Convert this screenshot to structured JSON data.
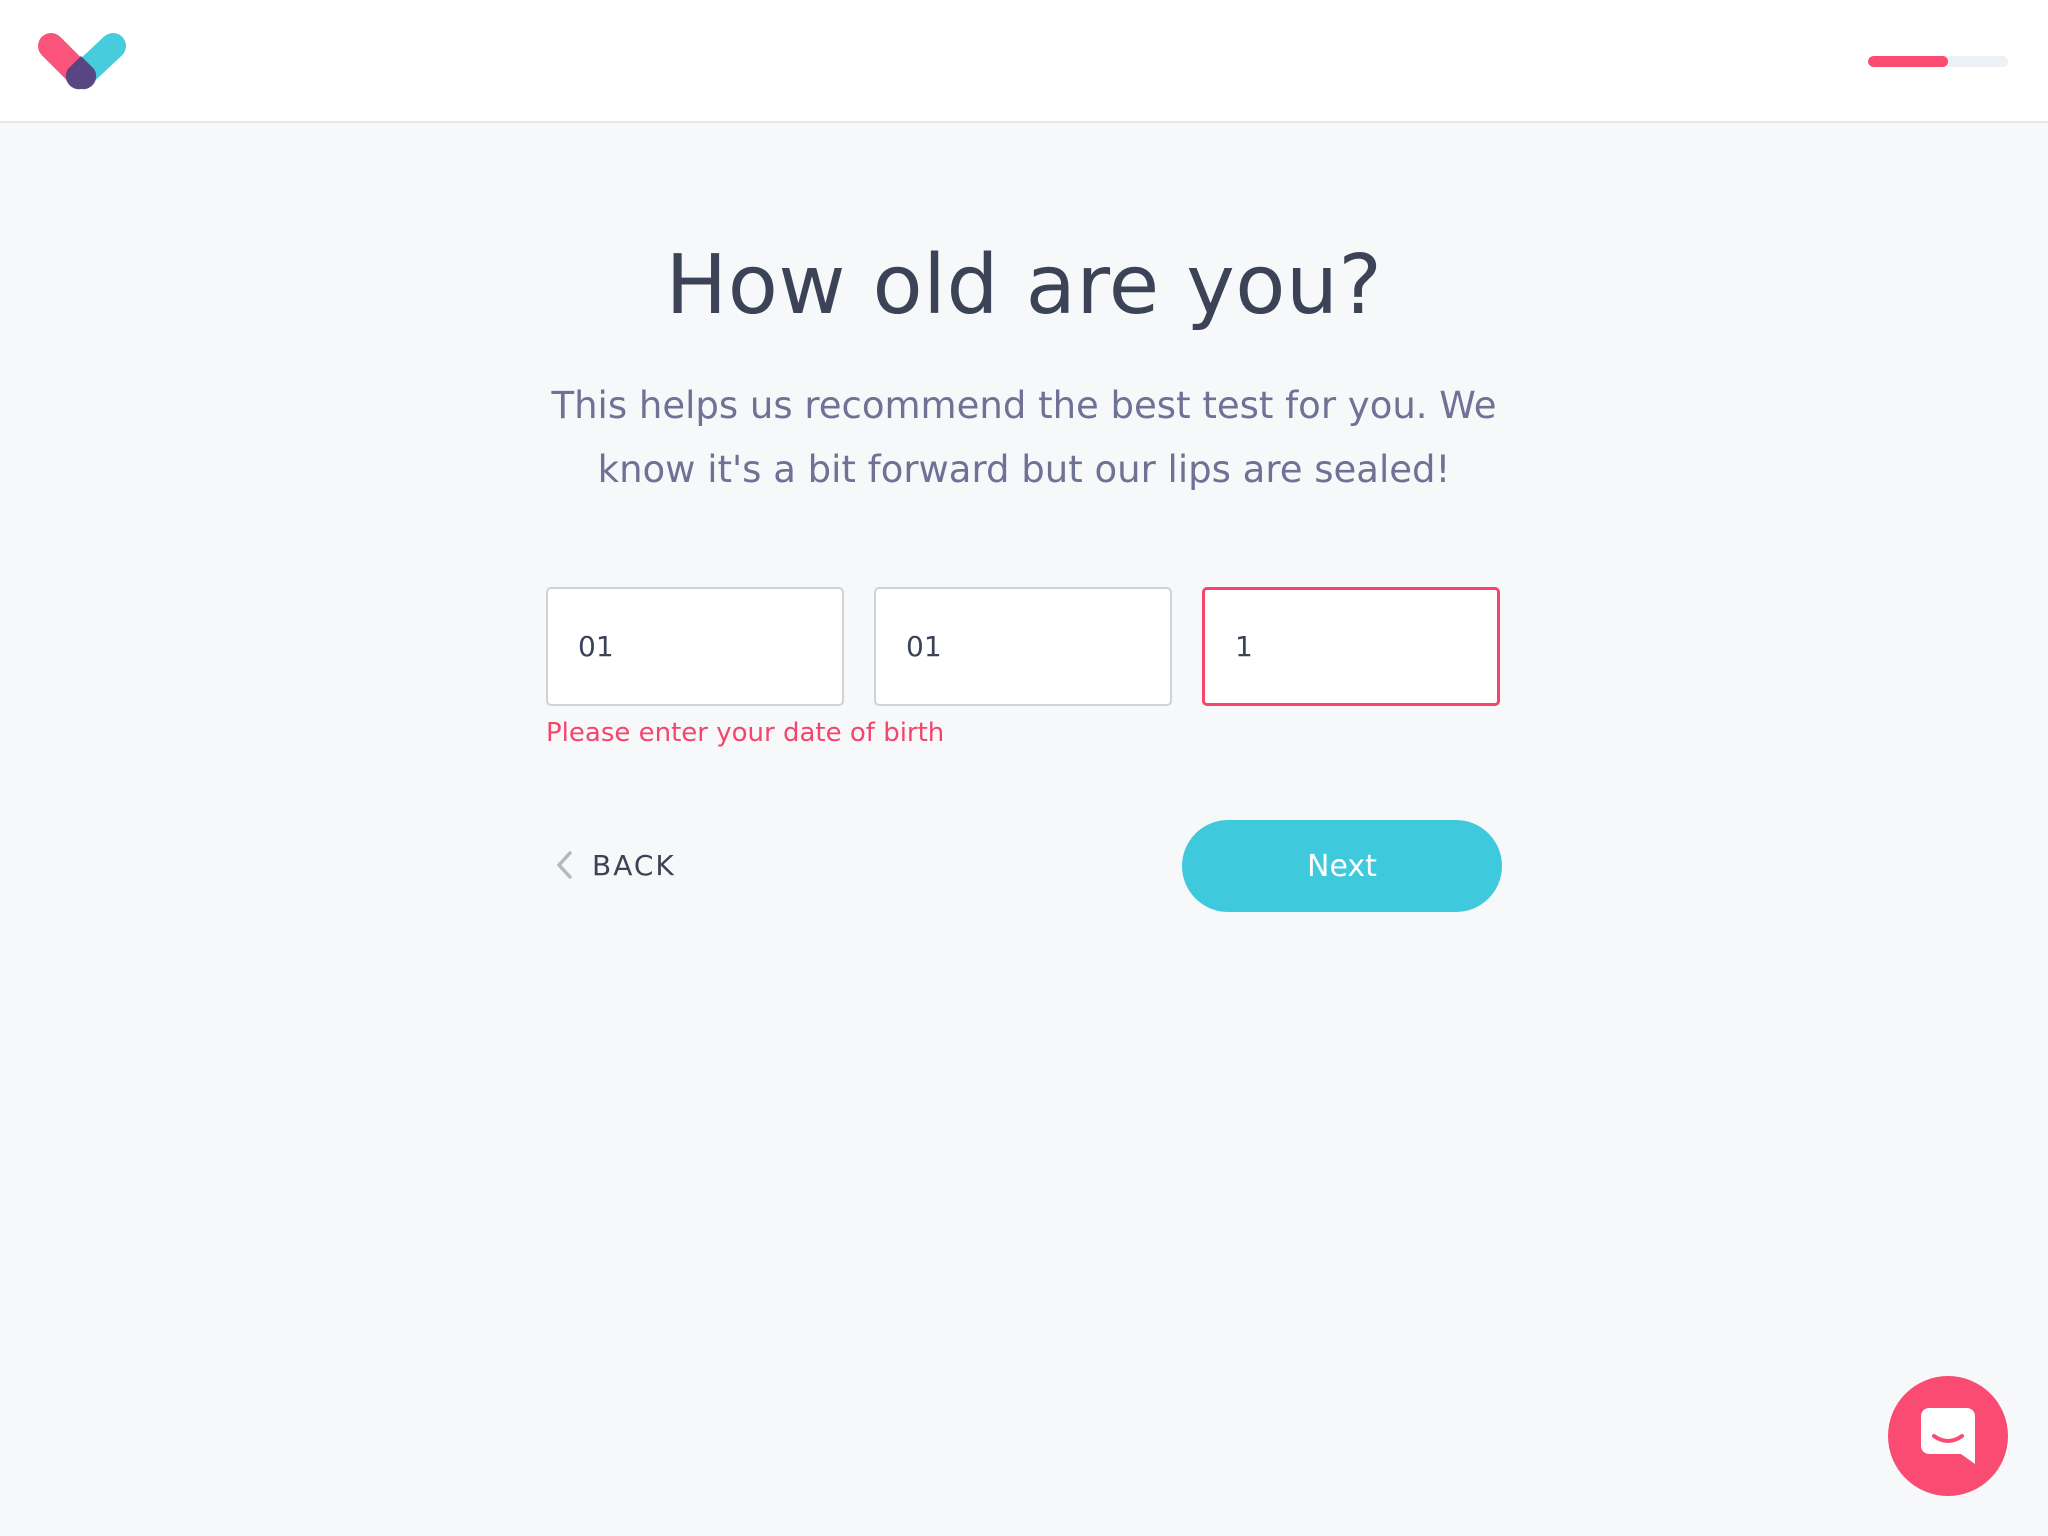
{
  "header": {
    "logo": "heart-logo-icon",
    "progress": 0.57,
    "colors": {
      "progress_fill": "#fa4b73",
      "progress_track": "#edf0f4"
    }
  },
  "main": {
    "title": "How old are you?",
    "subtitle": "This helps us recommend the best test for you. We know it's a bit forward but our lips are sealed!",
    "date_of_birth": {
      "day_value": "01",
      "month_value": "01",
      "year_value": "1",
      "error": "Please enter your date of birth"
    },
    "back_label": "BACK",
    "next_label": "Next"
  },
  "chat": {
    "icon": "chat-bubble-icon"
  },
  "colors": {
    "accent_teal": "#3ecadc",
    "accent_pink": "#fa4b73",
    "error": "#f5456b",
    "text_dark": "#3c4356",
    "text_muted": "#6f7294",
    "background": "#f7f8fa"
  }
}
